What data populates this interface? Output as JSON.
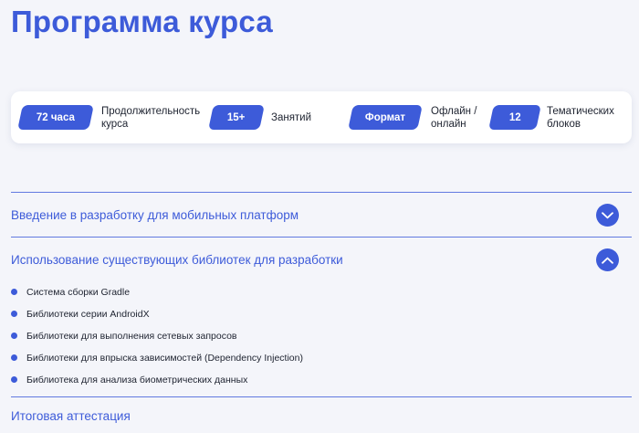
{
  "page": {
    "title": "Программа курса"
  },
  "stats": [
    {
      "badge": "72 часа",
      "desc": "Продолжительность\nкурса"
    },
    {
      "badge": "15+",
      "desc": "Занятий"
    },
    {
      "badge": "Формат",
      "desc": "Офлайн /\nонлайн"
    },
    {
      "badge": "12",
      "desc": "Тематических\nблоков"
    }
  ],
  "accordion": {
    "sections": [
      {
        "title": "Введение в разработку для мобильных платформ",
        "expanded": false,
        "items": []
      },
      {
        "title": "Использование существующих библиотек для разработки",
        "expanded": true,
        "items": [
          "Система сборки Gradle",
          "Библиотеки серии AndroidX",
          "Библиотеки для выполнения сетевых запросов",
          "Библиотеки для впрыска зависимостей (Dependency Injection)",
          "Библиотека для анализа биометрических данных"
        ]
      },
      {
        "title": "Итоговая аттестация",
        "expanded": false,
        "items": []
      }
    ]
  },
  "colors": {
    "accent": "#3d5bd9",
    "text": "#1e2330",
    "background": "#f4f5fa"
  },
  "icons": {
    "collapsed": "chevron-down-icon",
    "expanded": "chevron-up-icon"
  }
}
